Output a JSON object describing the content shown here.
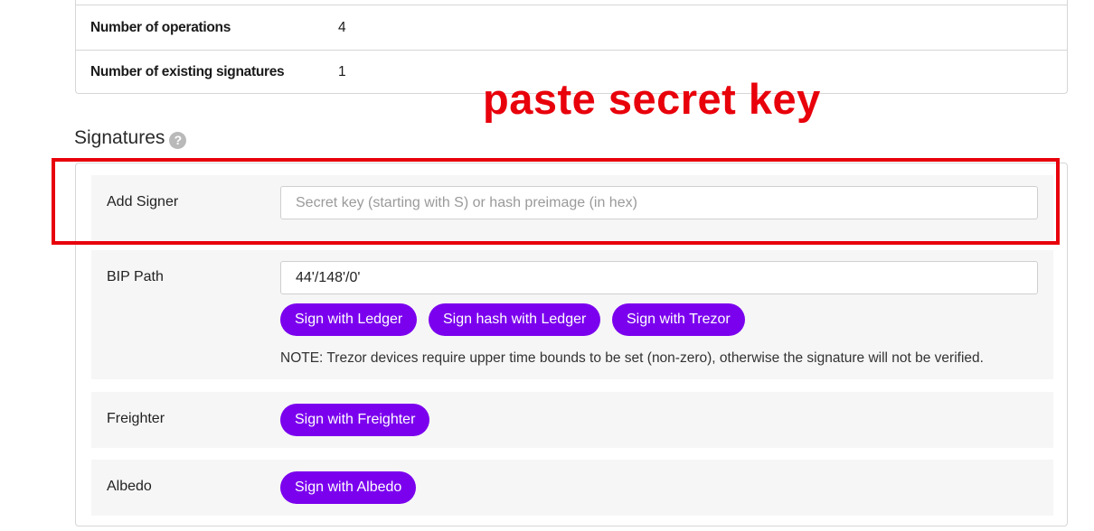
{
  "summary": {
    "rows": [
      {
        "label": "Number of operations",
        "value": "4"
      },
      {
        "label": "Number of existing signatures",
        "value": "1"
      }
    ]
  },
  "signatures": {
    "heading": "Signatures",
    "help_glyph": "?",
    "add_signer": {
      "label": "Add Signer",
      "placeholder": "Secret key (starting with S) or hash preimage (in hex)",
      "value": ""
    },
    "bip_path": {
      "label": "BIP Path",
      "value": "44'/148'/0'",
      "buttons": {
        "ledger": "Sign with Ledger",
        "hash_ledger": "Sign hash with Ledger",
        "trezor": "Sign with Trezor"
      },
      "note": "NOTE: Trezor devices require upper time bounds to be set (non-zero), otherwise the signature will not be verified."
    },
    "freighter": {
      "label": "Freighter",
      "button": "Sign with Freighter"
    },
    "albedo": {
      "label": "Albedo",
      "button": "Sign with Albedo"
    }
  },
  "annotation": {
    "text": "paste secret key",
    "color": "#e8000b"
  },
  "colors": {
    "accent": "#7b00ee",
    "annotation_red": "#e8000b"
  }
}
